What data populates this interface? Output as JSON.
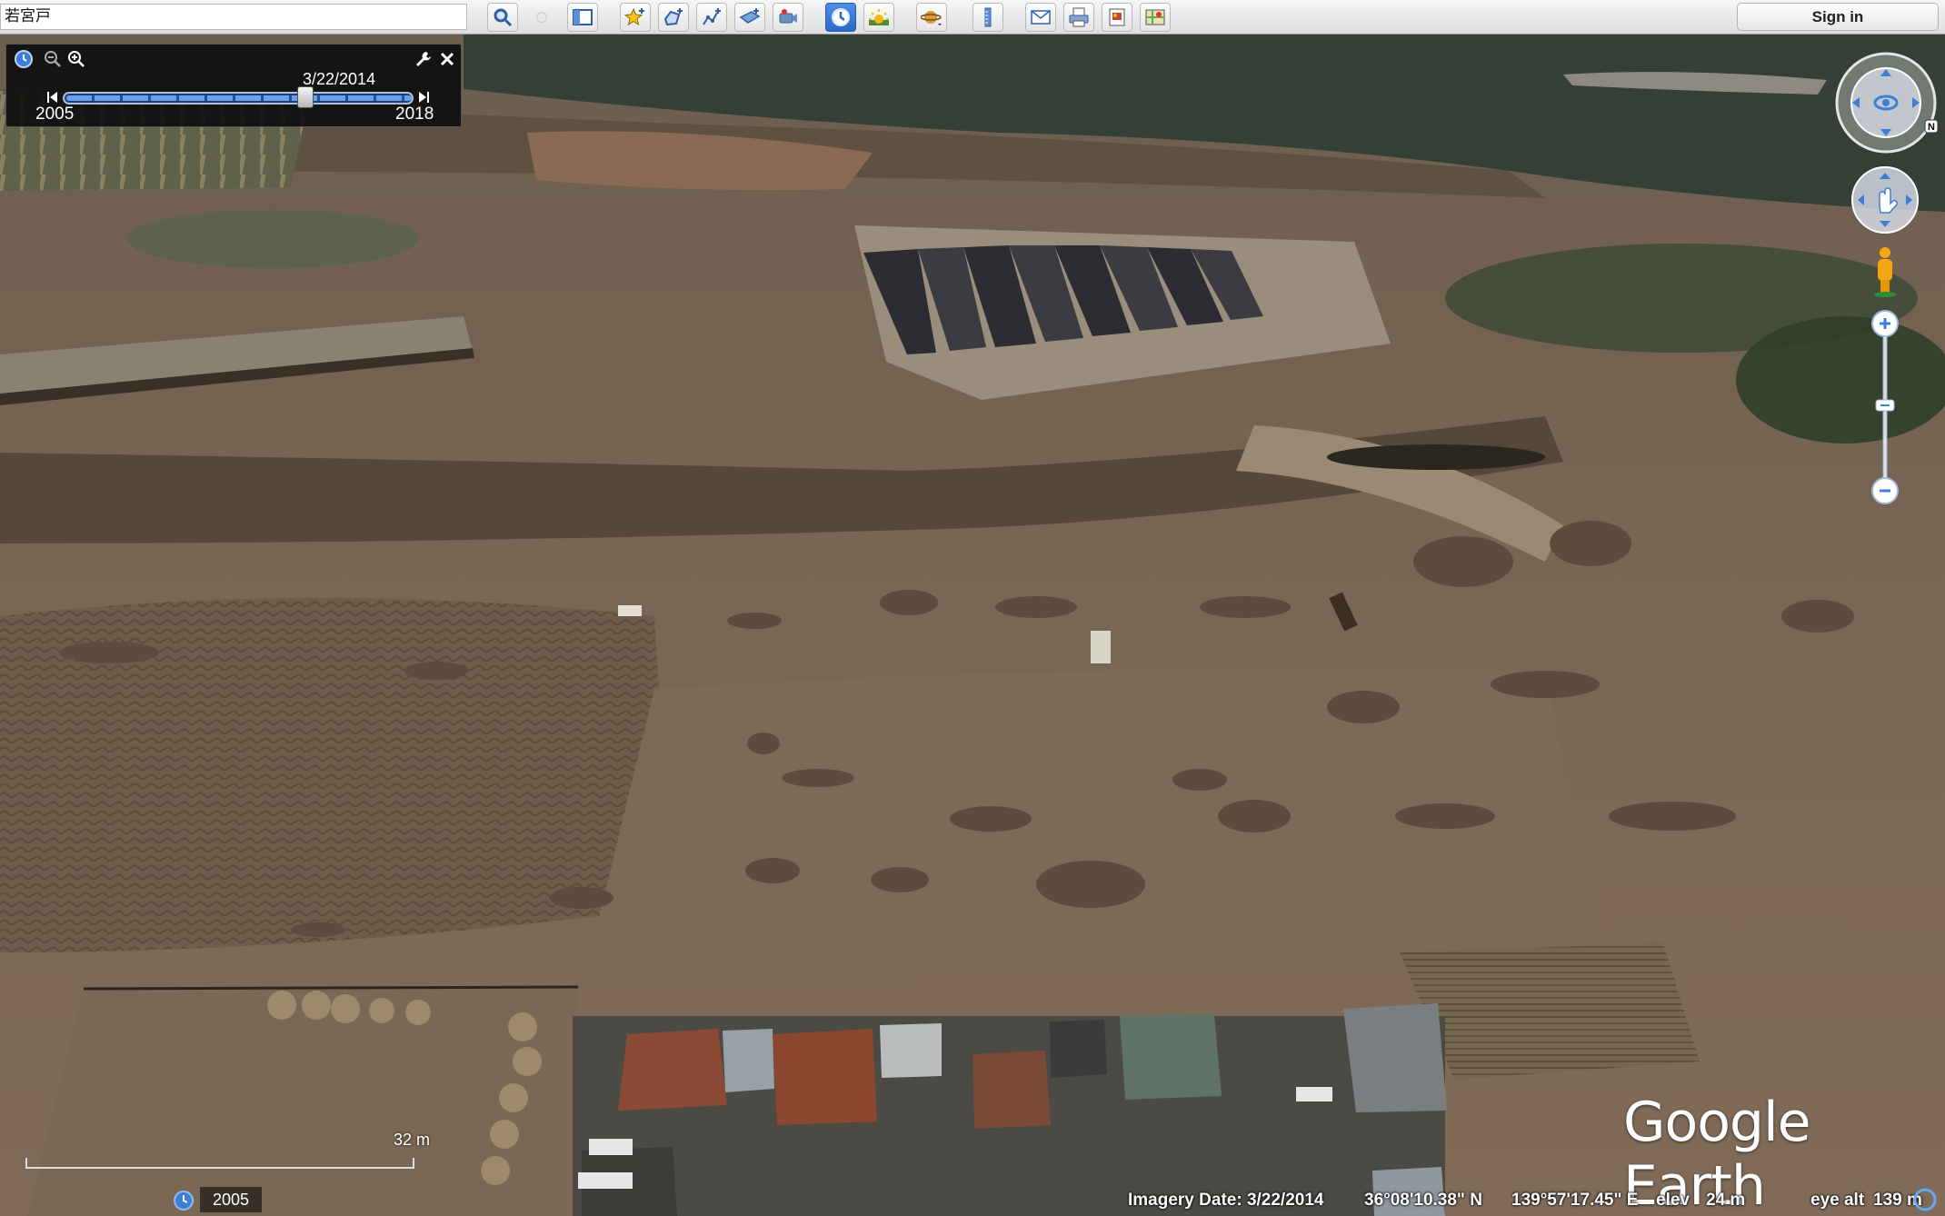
{
  "toolbar": {
    "search_value": "若宮戸",
    "sign_in_label": "Sign in",
    "buttons": [
      {
        "icon": "search-icon"
      },
      {
        "icon": "sidebar-toggle-icon"
      },
      {
        "icon": "add-placemark-icon"
      },
      {
        "icon": "add-polygon-icon"
      },
      {
        "icon": "add-path-icon"
      },
      {
        "icon": "image-overlay-icon"
      },
      {
        "icon": "record-tour-icon"
      },
      {
        "icon": "historical-imagery-icon",
        "active": true
      },
      {
        "icon": "sunlight-icon"
      },
      {
        "icon": "planets-icon"
      },
      {
        "icon": "ruler-icon"
      },
      {
        "icon": "email-icon"
      },
      {
        "icon": "print-icon"
      },
      {
        "icon": "save-image-icon"
      },
      {
        "icon": "view-in-maps-icon"
      }
    ]
  },
  "time_slider": {
    "current_date": "3/22/2014",
    "start_year": "2005",
    "end_year": "2018",
    "position_fraction": 0.7
  },
  "scale": {
    "label": "32 m"
  },
  "history": {
    "year": "2005"
  },
  "status": {
    "imagery_date_label": "Imagery Date: 3/22/2014",
    "latitude": "36°08'10.38\" N",
    "longitude": "139°57'17.45\" E",
    "elev_label": "elev",
    "elev_value": "24 m",
    "eye_alt_label": "eye alt",
    "eye_alt_value": "139 m"
  },
  "brand": {
    "name": "Google Earth"
  },
  "colors": {
    "accent": "#2a6bc8",
    "water": "#343f37",
    "ground": "#7d6a58"
  }
}
